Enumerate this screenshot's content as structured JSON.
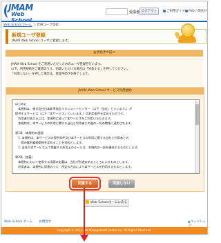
{
  "header": {
    "logo_line1": "JMAM",
    "logo_line2": "Web School",
    "user_label": "受講者 様",
    "logout_label": "ログアウト",
    "guide_label": "ご利用ガイド",
    "faq_label": "FAQ / 問合せ",
    "accent_color": "#1e63b8"
  },
  "breadcrumb": {
    "home": "Web School ホーム",
    "separator": " ＞ ",
    "current": "新規ユーザ登録"
  },
  "title": {
    "main": "新規ユーザ登録",
    "sub": "JMAM Web School ユーザに登録します。"
  },
  "notice": {
    "heading": "お手続きの前に",
    "lines": [
      "JMAM Web School をご利用いただくためのユーザ登録を行います。",
      "以下、利用規約をご確認のうえ、同意いただける場合は「同意する」を押してください。",
      "「同意しない」を押した場合は、登録手続きを終了します。"
    ]
  },
  "terms": {
    "heading": "JMAM Web School サービス利用規約",
    "lines": [
      "はじめに",
      "　本規約は、株式会社日本能率協会マネジメントセンター（以下「当社」といいます。）が",
      "提供するサービス（以下「本サービス」といいます。）の利用条件を定めるものです。",
      "　利用者の皆さまには、本規約に従って本サービスをご利用いただきます。",
      "　本規約は、本サービスの利用に関する当社と利用者との間の一切の関係に適用されます。",
      "",
      "第1条（本規約の適用）",
      "　1. 本規約は、本サービスの提供条件及び本サービスの利用に関する当社と利用者との",
      "　　間の権利義務関係を定めることを目的とします。",
      "　2. 当社が本サービス上で掲載する利用上のルールは、本規約の一部を構成するものとします。",
      "",
      "第2条（定義）",
      "　本規約において使用する用語の定義は、当社が別途定めるところによるものとします。",
      "　利用者は、本規約に同意のうえ、所定の方法により本サービスを利用するものとします。"
    ]
  },
  "buttons": {
    "agree": "同意する",
    "disagree": "同意しない",
    "back": "Web Schoolホームに戻る"
  },
  "footer": {
    "links": [
      "Web School ホーム",
      "お問合せ"
    ],
    "pagetop": "▲ページトップ",
    "copyright": "Copyright © 2013 JMA Management Center Inc. All Rights Reserved."
  }
}
